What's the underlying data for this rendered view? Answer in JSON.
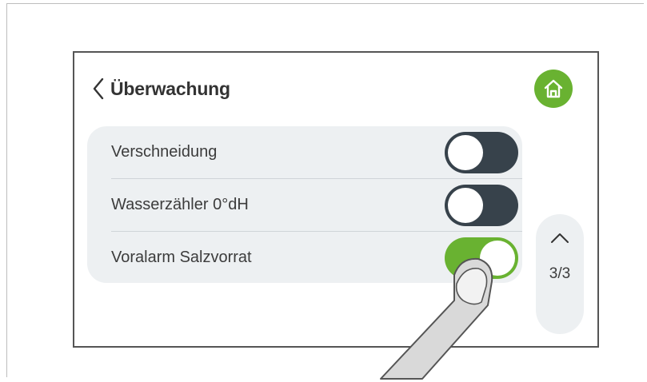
{
  "header": {
    "back_icon": "chevron-left-icon",
    "title": "Überwachung",
    "home_icon": "home-icon"
  },
  "settings": [
    {
      "label": "Verschneidung",
      "enabled": false
    },
    {
      "label": "Wasserzähler 0°dH",
      "enabled": false
    },
    {
      "label": "Voralarm Salzvorrat",
      "enabled": true
    }
  ],
  "pager": {
    "up_icon": "chevron-up-icon",
    "page_indicator": "3/3"
  },
  "overlay": {
    "icon": "pointing-finger-icon"
  },
  "colors": {
    "accent_green": "#69b231",
    "toggle_off": "#37424b",
    "list_background": "#edf0f2",
    "text": "#3c3c3c"
  }
}
